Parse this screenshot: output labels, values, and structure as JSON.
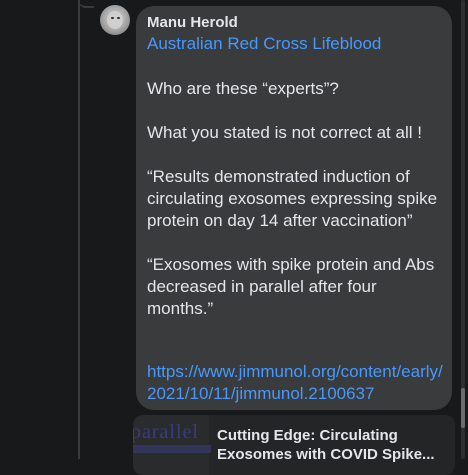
{
  "comment": {
    "author": "Manu Herold",
    "mention": "Australian Red Cross Lifeblood",
    "body": "Who are these “experts”?\n\nWhat you stated is not correct at all !\n\n“Results demonstrated induction of circulating exosomes expressing spike protein on day 14 after vaccination”\n\n“Exosomes with spike protein and Abs decreased in parallel after four months.”",
    "link": "https://www.jimmunol.org/content/early/2021/10/11/jimmunol.2100637"
  },
  "preview": {
    "thumbnail_text": "parallel",
    "title": "Cutting Edge: Circulating Exosomes with COVID Spike..."
  },
  "colors": {
    "background": "#18191a",
    "bubble": "#3a3b3c",
    "text": "#e4e6eb",
    "link": "#4599ff"
  },
  "icons": {
    "avatar": "profile-photo"
  }
}
